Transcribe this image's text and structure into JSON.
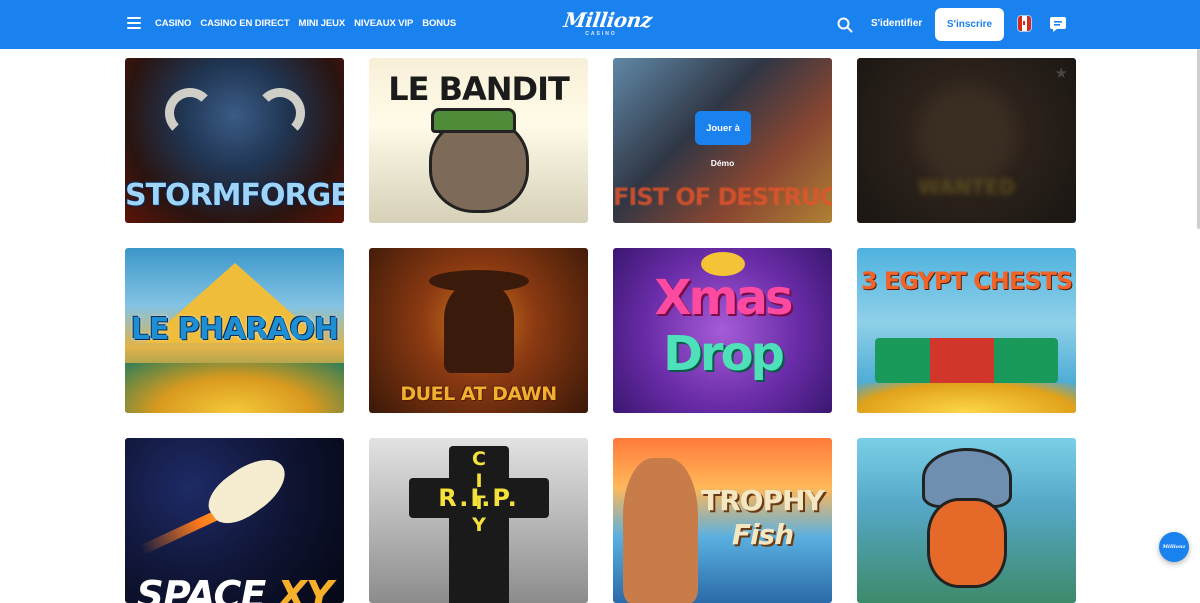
{
  "header": {
    "nav": [
      {
        "label": "CASINO"
      },
      {
        "label": "CASINO EN DIRECT"
      },
      {
        "label": "MINI JEUX"
      },
      {
        "label": "NIVEAUX VIP"
      },
      {
        "label": "BONUS"
      }
    ],
    "logo": {
      "brand": "Millionz",
      "sub": "CASINO"
    },
    "login_label": "S'identifier",
    "signup_label": "S'inscrire",
    "language_flag": "fr-ca"
  },
  "games": [
    {
      "title": "STORMFORGED"
    },
    {
      "title": "LE BANDIT"
    },
    {
      "title": "FIST OF DESTRUCTION",
      "hover_play": "Jouer à",
      "hover_demo": "Démo"
    },
    {
      "title": "WANTED"
    },
    {
      "title": "LE PHARAOH"
    },
    {
      "title": "DUEL AT DAWN"
    },
    {
      "title_line1": "Xmas",
      "title_line2": "Drop"
    },
    {
      "title": "3 EGYPT CHESTS"
    },
    {
      "title_a": "SPACE",
      "title_b": "XY"
    },
    {
      "title": "R.I.P.",
      "sub": "CITY"
    },
    {
      "title_line1": "TROPHY",
      "title_line2": "Fish"
    },
    {
      "title": ""
    }
  ],
  "colors": {
    "primary": "#1a82ef",
    "white": "#ffffff"
  },
  "icons": [
    "menu-icon",
    "search-icon",
    "canada-flag-icon",
    "chat-icon",
    "favorite-star-icon"
  ]
}
